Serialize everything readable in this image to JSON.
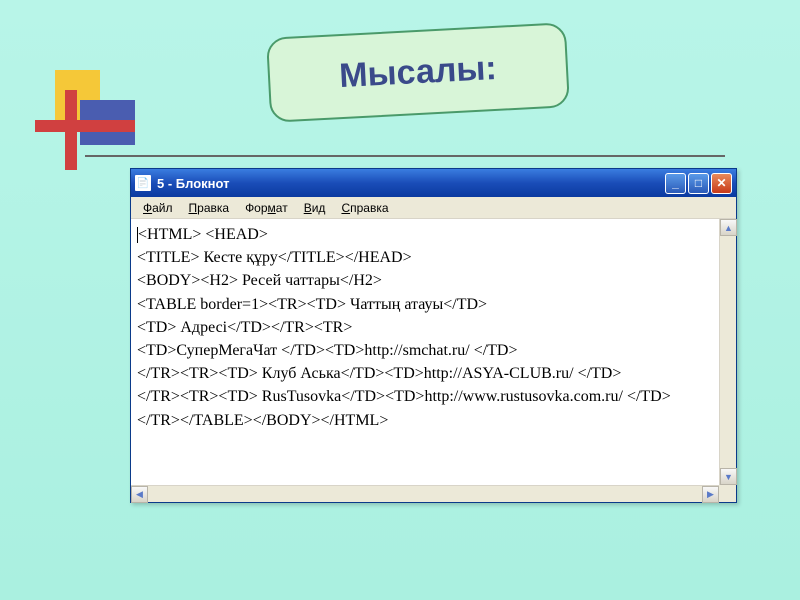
{
  "slide": {
    "title": "Мысалы:"
  },
  "window": {
    "title": "5 - Блокнот"
  },
  "menu": {
    "file": "Файл",
    "edit": "Правка",
    "format": "Формат",
    "view": "Вид",
    "help": "Справка"
  },
  "editor": {
    "line1": "<HTML> <HEAD>",
    "line2": "<TITLE> Кесте құру</TITLE></HEAD>",
    "line3": "<BODY><H2> Ресей чаттары</H2>",
    "line4": "<TABLE border=1><TR><TD> Чаттың атауы</TD>",
    "line5": "<TD> Адресі</TD></TR><TR>",
    "line6": "<TD>СуперМегаЧат </TD><TD>http://smchat.ru/ </TD>",
    "line7": "</TR><TR><TD> Клуб Аська</TD><TD>http://ASYA-CLUB.ru/ </TD>",
    "line8": "</TR><TR><TD> RusTusovka</TD><TD>http://www.rustusovka.com.ru/ </TD>",
    "line9": "</TR></TABLE></BODY></HTML>"
  }
}
